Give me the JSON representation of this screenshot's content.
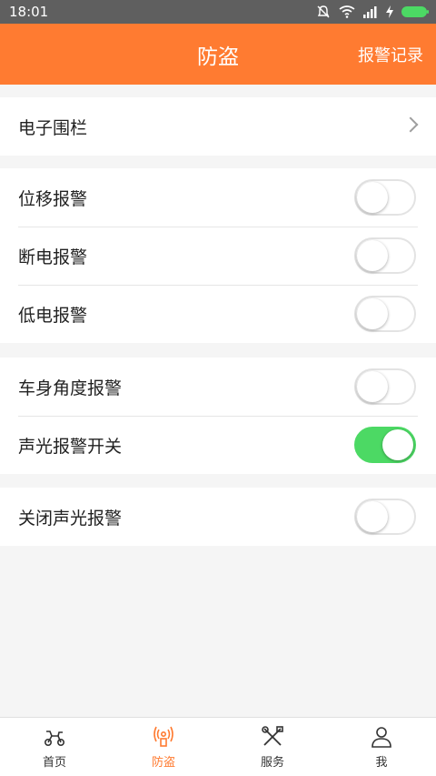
{
  "statusbar": {
    "time": "18:01"
  },
  "header": {
    "title": "防盗",
    "right_label": "报警记录"
  },
  "groups": {
    "fence": {
      "label": "电子围栏"
    },
    "alarms": [
      {
        "label": "位移报警",
        "on": false
      },
      {
        "label": "断电报警",
        "on": false
      },
      {
        "label": "低电报警",
        "on": false
      }
    ],
    "alarms2": [
      {
        "label": "车身角度报警",
        "on": false
      },
      {
        "label": "声光报警开关",
        "on": true
      }
    ],
    "alarms3": [
      {
        "label": "关闭声光报警",
        "on": false
      }
    ]
  },
  "tabs": [
    {
      "label": "首页",
      "icon": "scooter-icon"
    },
    {
      "label": "防盗",
      "icon": "antenna-icon",
      "active": true
    },
    {
      "label": "服务",
      "icon": "tools-icon"
    },
    {
      "label": "我",
      "icon": "person-icon"
    }
  ],
  "colors": {
    "accent": "#ff7b31",
    "toggle_on": "#4cd964"
  }
}
